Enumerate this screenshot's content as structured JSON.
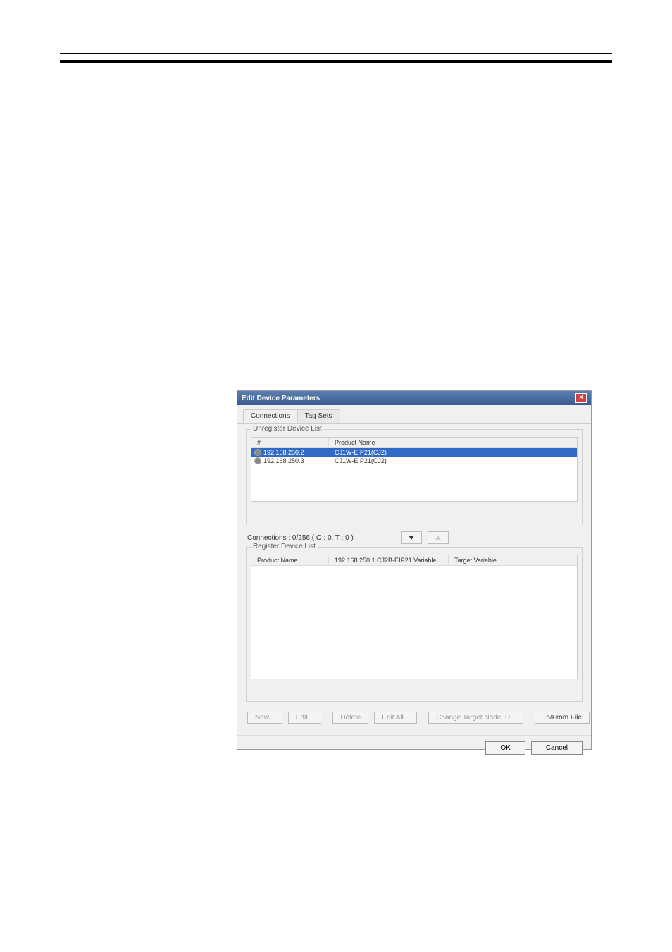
{
  "dialog": {
    "title": "Edit Device Parameters",
    "tabs": {
      "connections": "Connections",
      "tagsets": "Tag Sets"
    },
    "unregister": {
      "label": "Unregister Device List",
      "header_num": "#",
      "header_product": "Product Name",
      "rows": [
        {
          "ip": "192.168.250.2",
          "product": "CJ1W-EIP21(CJ2)"
        },
        {
          "ip": "192.168.250.3",
          "product": "CJ1W-EIP21(CJ2)"
        }
      ]
    },
    "connections_status": "Connections :  0/256 ( O : 0, T : 0 )",
    "register": {
      "label": "Register Device List",
      "header_product": "Product Name",
      "header_variable": "192.168.250.1 CJ2B-EIP21 Variable",
      "header_target": "Target Variable"
    },
    "buttons": {
      "new": "New...",
      "edit": "Edit...",
      "delete": "Delete",
      "editall": "Edit All...",
      "change_target": "Change Target Node ID...",
      "tofrom": "To/From File"
    },
    "bottom": {
      "ok": "OK",
      "cancel": "Cancel"
    }
  }
}
